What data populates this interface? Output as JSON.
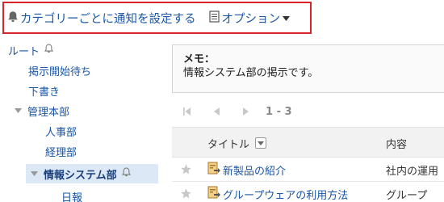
{
  "toolbar": {
    "notify_label": "カテゴリーごとに通知を設定する",
    "option_label": "オプション"
  },
  "sidebar": {
    "items": [
      {
        "label": "ルート",
        "level": 0,
        "toggle": "none",
        "bell": true,
        "selected": false
      },
      {
        "label": "掲示開始待ち",
        "level": 1,
        "toggle": "none",
        "bell": false,
        "selected": false
      },
      {
        "label": "下書き",
        "level": 1,
        "toggle": "none",
        "bell": false,
        "selected": false
      },
      {
        "label": "管理本部",
        "level": 1,
        "toggle": "expanded",
        "bell": false,
        "selected": false
      },
      {
        "label": "人事部",
        "level": 2,
        "toggle": "none",
        "bell": false,
        "selected": false
      },
      {
        "label": "経理部",
        "level": 2,
        "toggle": "none",
        "bell": false,
        "selected": false
      },
      {
        "label": "情報システム部",
        "level": 2,
        "toggle": "expanded",
        "bell": true,
        "selected": true
      },
      {
        "label": "日報",
        "level": 3,
        "toggle": "none",
        "bell": false,
        "selected": false
      }
    ]
  },
  "memo": {
    "label": "メモ：",
    "text": "情報システム部の掲示です。"
  },
  "pager": {
    "range": "1 - 3"
  },
  "table": {
    "headers": {
      "title": "タイトル",
      "content": "内容"
    },
    "rows": [
      {
        "title": "新製品の紹介",
        "content": "社内の運用"
      },
      {
        "title": "グループウェアの利用方法",
        "content": "グループ"
      }
    ]
  },
  "colors": {
    "link": "#1a55a6",
    "highlight_border": "#d9232b",
    "selected_bg": "#dce8f5"
  },
  "icons": {
    "notify": "bell-icon",
    "option": "document-icon",
    "row": "bulletin-icon",
    "favorite": "star-icon"
  }
}
